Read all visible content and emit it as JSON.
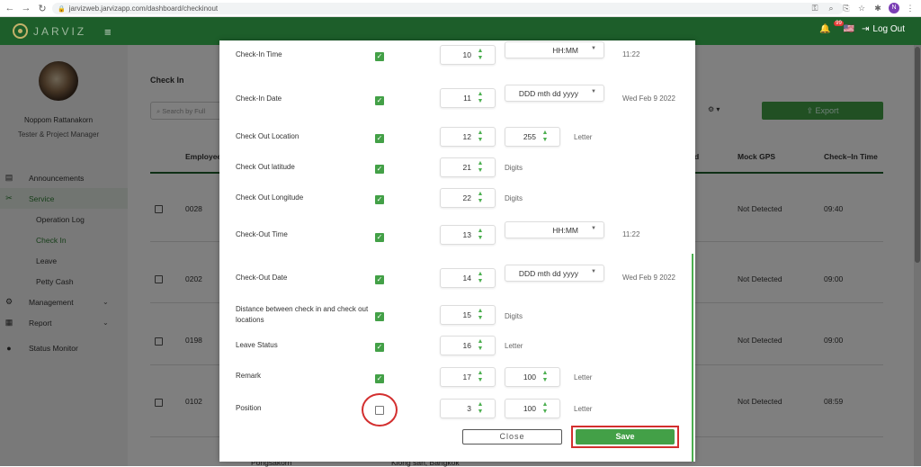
{
  "browser": {
    "url": "jarvizweb.jarvizapp.com/dashboard/checkinout",
    "profile_initial": "N"
  },
  "topbar": {
    "brand": "JARVIZ",
    "notification_count": "99",
    "logout_label": "Log Out"
  },
  "sidebar": {
    "user_name": "Noppom Rattanakorn",
    "user_role": "Tester & Project Manager",
    "items": [
      {
        "label": "Announcements",
        "icon": "announcement-icon"
      },
      {
        "label": "Service",
        "icon": "tools-icon",
        "active": true
      },
      {
        "label": "Operation Log"
      },
      {
        "label": "Check In",
        "active": true
      },
      {
        "label": "Leave"
      },
      {
        "label": "Petty Cash"
      },
      {
        "label": "Management",
        "icon": "gear-icon"
      },
      {
        "label": "Report",
        "icon": "report-icon"
      },
      {
        "label": "Status Monitor",
        "icon": "location-icon"
      }
    ]
  },
  "main": {
    "title": "Check In",
    "search_placeholder": "Search by Full",
    "export_label": "Export",
    "columns": [
      "Employee",
      "d",
      "Mock GPS",
      "Check–In Time"
    ],
    "rows": [
      {
        "id": "0028",
        "gps": "Not Detected",
        "time": "09:40"
      },
      {
        "id": "0202",
        "gps": "Not Detected",
        "time": "09:00"
      },
      {
        "id": "0198",
        "gps": "Not Detected",
        "time": "09:00"
      },
      {
        "id": "0102",
        "gps": "Not Detected",
        "time": "08:59"
      }
    ],
    "footer_left": "Pongsakorn",
    "footer_right": "Klong san, Bangkok"
  },
  "modal": {
    "fields": [
      {
        "label": "Check-In Time",
        "checked": true,
        "order": "10",
        "format": "HH:MM",
        "hint": "11:22"
      },
      {
        "label": "Check-In Date",
        "checked": true,
        "order": "11",
        "format": "DDD mth dd yyyy",
        "hint": "Wed Feb 9 2022"
      },
      {
        "label": "Check Out Location",
        "checked": true,
        "order": "12",
        "length": "255",
        "hint": "Letter"
      },
      {
        "label": "Check Out latitude",
        "checked": true,
        "order": "21",
        "hint": "Digits"
      },
      {
        "label": "Check Out Longitude",
        "checked": true,
        "order": "22",
        "hint": "Digits"
      },
      {
        "label": "Check-Out Time",
        "checked": true,
        "order": "13",
        "format": "HH:MM",
        "hint": "11:22"
      },
      {
        "label": "Check-Out Date",
        "checked": true,
        "order": "14",
        "format": "DDD mth dd yyyy",
        "hint": "Wed Feb 9 2022"
      },
      {
        "label": "Distance between check in and check out locations",
        "checked": true,
        "order": "15",
        "hint": "Digits"
      },
      {
        "label": "Leave Status",
        "checked": true,
        "order": "16",
        "hint": "Letter"
      },
      {
        "label": "Remark",
        "checked": true,
        "order": "17",
        "length": "100",
        "hint": "Letter"
      },
      {
        "label": "Position",
        "checked": false,
        "order": "3",
        "length": "100",
        "hint": "Letter"
      }
    ],
    "close_label": "Close",
    "save_label": "Save"
  },
  "icons": {
    "check": "✓",
    "spin_up": "▲",
    "spin_down": "▼",
    "caret": "▼"
  },
  "colors": {
    "brand_green": "#1d5e2a",
    "accent_green": "#43a047",
    "highlight_red": "#d32f2f"
  }
}
